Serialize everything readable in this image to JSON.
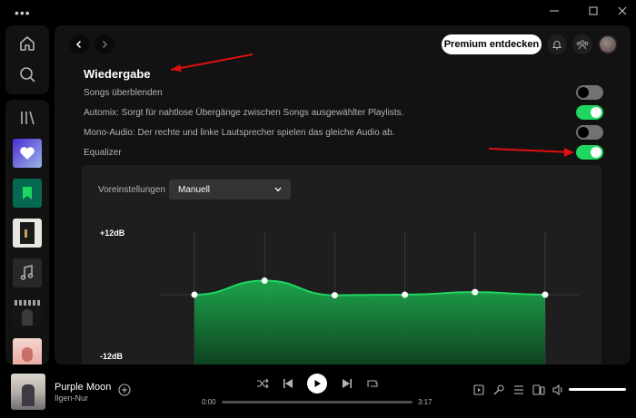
{
  "window": {
    "menu_icon": "more-dots-icon",
    "controls": [
      "minimize-icon",
      "maximize-icon",
      "close-icon"
    ]
  },
  "sidebar": {
    "nav": [
      "home-icon",
      "search-icon"
    ],
    "library_icon": "library-icon",
    "items": [
      {
        "name": "liked-songs",
        "icon": "heart-icon",
        "color": "#6f4ee0"
      },
      {
        "name": "your-episodes",
        "icon": "bookmark-icon",
        "color": "#056952"
      },
      {
        "name": "playlist-1",
        "icon": "",
        "color": "#e8e6df"
      },
      {
        "name": "playlist-2",
        "icon": "music-note-icon",
        "color": "#282828"
      },
      {
        "name": "playlist-3",
        "icon": "",
        "color": "#1c1c1c"
      },
      {
        "name": "playlist-4",
        "icon": "",
        "color": "#f0c7c0"
      }
    ]
  },
  "header": {
    "back_icon": "chevron-left-icon",
    "forward_icon": "chevron-right-icon",
    "premium_label": "Premium entdecken",
    "bell_icon": "bell-icon",
    "friends_icon": "friends-icon"
  },
  "playback": {
    "title": "Wiedergabe",
    "settings": [
      {
        "label": "Songs überblenden",
        "on": false
      },
      {
        "label": "Automix: Sorgt für nahtlose Übergänge zwischen Songs ausgewählter Playlists.",
        "on": true
      },
      {
        "label": "Mono-Audio: Der rechte und linke Lautsprecher spielen das gleiche Audio ab.",
        "on": false
      },
      {
        "label": "Equalizer",
        "on": true
      }
    ]
  },
  "equalizer": {
    "preset_label": "Voreinstellungen",
    "preset_value": "Manuell",
    "top_label": "+12dB",
    "bottom_label": "-12dB",
    "bands_db": [
      0,
      2.7,
      -0.1,
      0,
      0.5,
      0
    ]
  },
  "player": {
    "track_title": "Purple Moon",
    "artist": "Ilgen-Nur",
    "add_icon": "plus-circle-icon",
    "current_time": "0:00",
    "total_time": "3:17",
    "progress": 0,
    "volume": 1.0,
    "controls": [
      "shuffle-icon",
      "previous-icon",
      "play-icon",
      "next-icon",
      "repeat-icon"
    ],
    "right_controls": [
      "now-playing-icon",
      "microphone-icon",
      "queue-icon",
      "devices-icon",
      "volume-icon"
    ]
  },
  "colors": {
    "accent": "#1ed760",
    "annotation": "#e01010"
  }
}
